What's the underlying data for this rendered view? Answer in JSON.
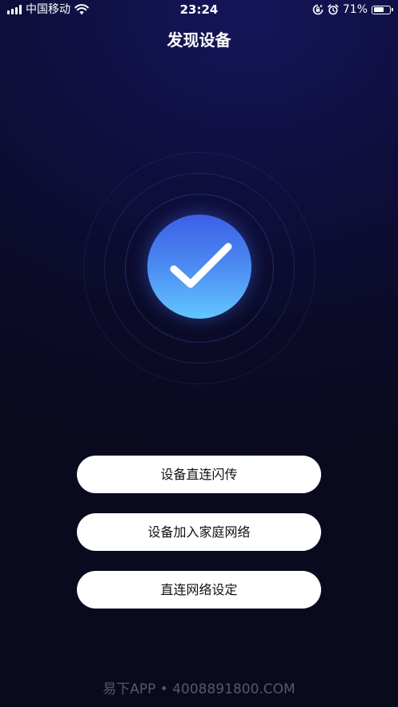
{
  "status_bar": {
    "carrier": "中国移动",
    "time": "23:24",
    "battery_percent": "71%",
    "battery_level": 0.71,
    "icons": [
      "signal-icon",
      "wifi-icon",
      "rotation-lock-icon",
      "alarm-icon",
      "battery-icon"
    ]
  },
  "header": {
    "title": "发现设备"
  },
  "success_graphic": {
    "icon": "checkmark-icon",
    "colors": {
      "top": "#3d5fe8",
      "bottom": "#62c7ff",
      "ring": "#4a5ed0"
    }
  },
  "actions": [
    {
      "label": "设备直连闪传"
    },
    {
      "label": "设备加入家庭网络"
    },
    {
      "label": "直连网络设定"
    }
  ],
  "watermark": {
    "text": "易下APP • 4008891800.COM"
  },
  "colors": {
    "background": "#0b0b28",
    "button_bg": "#ffffff",
    "button_text": "#111111"
  }
}
